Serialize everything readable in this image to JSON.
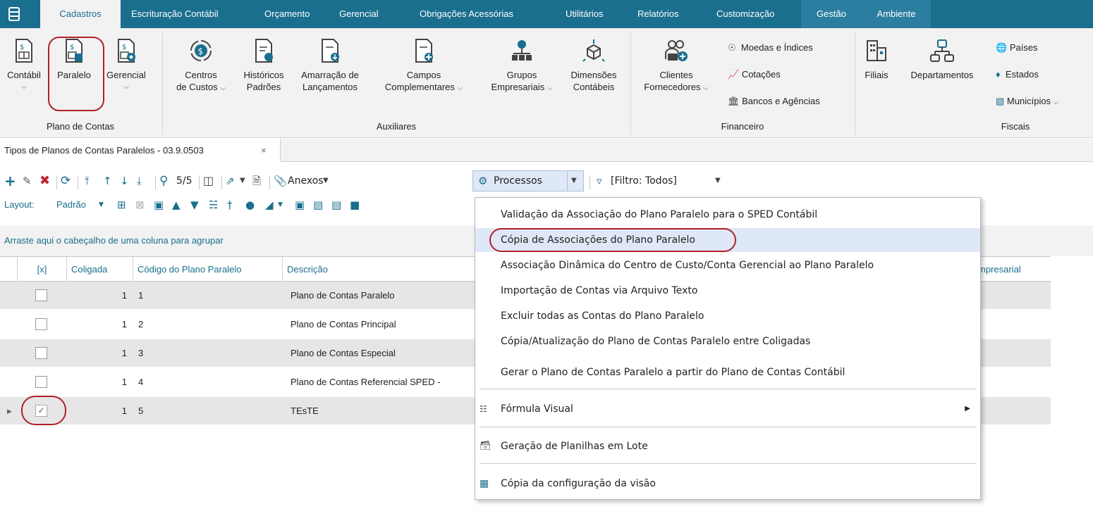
{
  "tabs": [
    "Cadastros",
    "Escrituração Contábil",
    "Orçamento",
    "Gerencial",
    "Obrigações Acessórias",
    "Utilitários",
    "Relatórios",
    "Customização",
    "Gestão",
    "Ambiente"
  ],
  "ribbon": {
    "plano": {
      "contabil": "Contábil",
      "paralelo": "Paralelo",
      "gerencial": "Gerencial",
      "group": "Plano de Contas"
    },
    "aux": {
      "centros1": "Centros",
      "centros2": "de Custos",
      "hist1": "Históricos",
      "hist2": "Padrões",
      "amar1": "Amarração de",
      "amar2": "Lançamentos",
      "campos1": "Campos",
      "campos2": "Complementares",
      "grupos1": "Grupos",
      "grupos2": "Empresariais",
      "dim1": "Dimensões",
      "dim2": "Contábeis",
      "group": "Auxiliares"
    },
    "fin": {
      "clientes1": "Clientes",
      "clientes2": "Fornecedores",
      "moedas": "Moedas e Índices",
      "cotacoes": "Cotações",
      "bancos": "Bancos e Agências",
      "group": "Financeiro"
    },
    "fiscais": {
      "filiais": "Filiais",
      "departamentos": "Departamentos",
      "paises": "Países",
      "estados": "Estados",
      "municipios": "Municípios",
      "group": "Fiscais"
    }
  },
  "doctab": {
    "title": "Tipos de Planos de Contas Paralelos - 03.9.0503",
    "close": "×"
  },
  "toolbar": {
    "counter": "5/5",
    "anexos": "Anexos",
    "processos": "Processos",
    "filtro": "[Filtro: Todos]",
    "layout_label": "Layout:",
    "layout_value": "Padrão"
  },
  "grouphint": "Arraste aqui o cabeçalho de uma coluna para agrupar",
  "grid": {
    "headers": {
      "check": "[x]",
      "coligada": "Coligada",
      "codigo": "Código do Plano Paralelo",
      "descricao": "Descrição",
      "empresarial": "mpresarial"
    },
    "rows": [
      {
        "coligada": "1",
        "codigo": "1",
        "descricao": "Plano de Contas Paralelo",
        "checked": false
      },
      {
        "coligada": "1",
        "codigo": "2",
        "descricao": "Plano de Contas Principal",
        "checked": false
      },
      {
        "coligada": "1",
        "codigo": "3",
        "descricao": "Plano de Contas Especial",
        "checked": false
      },
      {
        "coligada": "1",
        "codigo": "4",
        "descricao": "Plano de Contas Referencial SPED -",
        "checked": false
      },
      {
        "coligada": "1",
        "codigo": "5",
        "descricao": "TEsTE",
        "checked": true
      }
    ]
  },
  "menu": {
    "items": [
      "Validação da Associação do Plano Paralelo para o SPED Contábil",
      "Cópia de Associações do Plano Paralelo",
      "Associação Dinâmica do Centro de Custo/Conta Gerencial ao Plano Paralelo",
      "Importação de Contas via Arquivo Texto",
      "Excluir todas as Contas do Plano Paralelo",
      "Cópia/Atualização do Plano de Contas Paralelo entre Coligadas",
      "Gerar o Plano de Contas Paralelo a partir do Plano de Contas Contábil"
    ],
    "formula": "Fórmula Visual",
    "planilhas": "Geração de Planilhas em Lote",
    "copia_visao": "Cópia da configuração da visão"
  },
  "colors": {
    "accent": "#1a6e8e",
    "highlight_oval": "#b0202a",
    "menu_highlight": "#dfe8f6"
  }
}
